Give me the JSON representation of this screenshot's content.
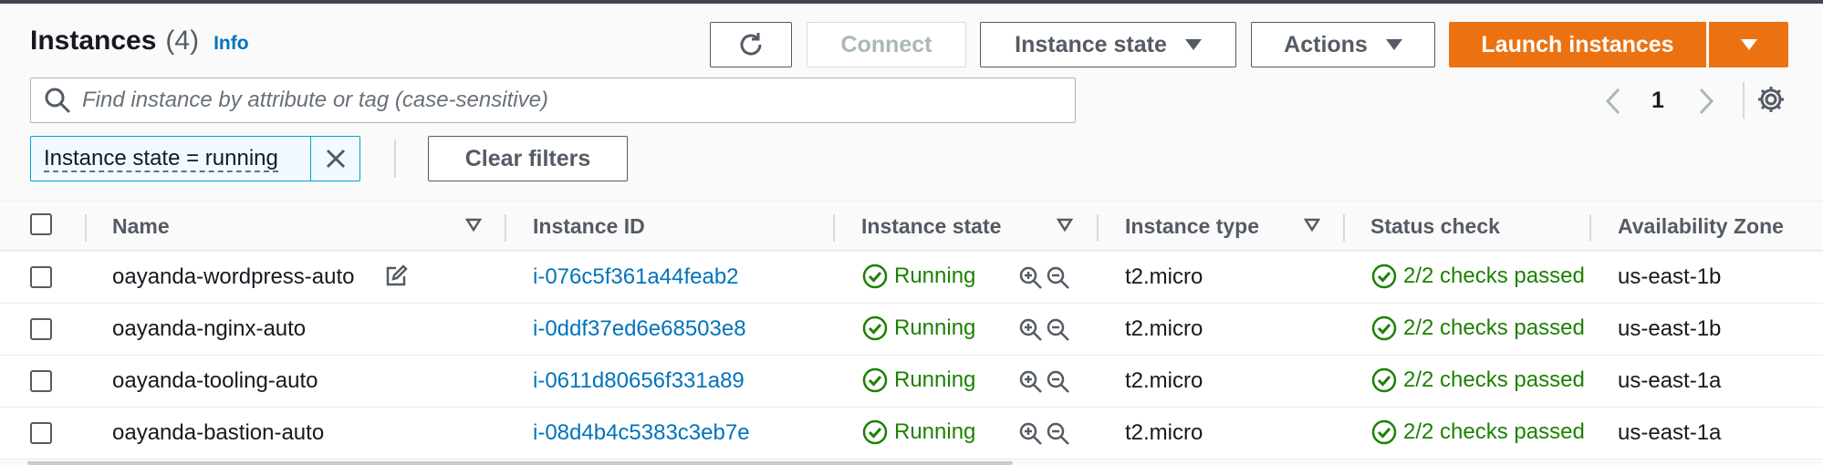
{
  "header": {
    "title": "Instances",
    "count": "(4)",
    "info_label": "Info"
  },
  "toolbar": {
    "refresh_icon": "refresh-icon",
    "connect_label": "Connect",
    "instance_state_label": "Instance state",
    "actions_label": "Actions",
    "launch_label": "Launch instances"
  },
  "search": {
    "placeholder": "Find instance by attribute or tag (case-sensitive)",
    "value": ""
  },
  "pagination": {
    "current_page": "1"
  },
  "filters": {
    "token_label": "Instance state = running",
    "clear_label": "Clear filters"
  },
  "table": {
    "columns": [
      "Name",
      "Instance ID",
      "Instance state",
      "Instance type",
      "Status check",
      "Availability Zone"
    ],
    "rows": [
      {
        "name": "oayanda-wordpress-auto",
        "id": "i-076c5f361a44feab2",
        "state": "Running",
        "type": "t2.micro",
        "status": "2/2 checks passed",
        "az": "us-east-1b"
      },
      {
        "name": "oayanda-nginx-auto",
        "id": "i-0ddf37ed6e68503e8",
        "state": "Running",
        "type": "t2.micro",
        "status": "2/2 checks passed",
        "az": "us-east-1b"
      },
      {
        "name": "oayanda-tooling-auto",
        "id": "i-0611d80656f331a89",
        "state": "Running",
        "type": "t2.micro",
        "status": "2/2 checks passed",
        "az": "us-east-1a"
      },
      {
        "name": "oayanda-bastion-auto",
        "id": "i-08d4b4c5383c3eb7e",
        "state": "Running",
        "type": "t2.micro",
        "status": "2/2 checks passed",
        "az": "us-east-1a"
      }
    ]
  },
  "colors": {
    "primary": "#ec7211",
    "link": "#0073bb",
    "success": "#1d8102",
    "filter_border": "#00a1c9"
  }
}
